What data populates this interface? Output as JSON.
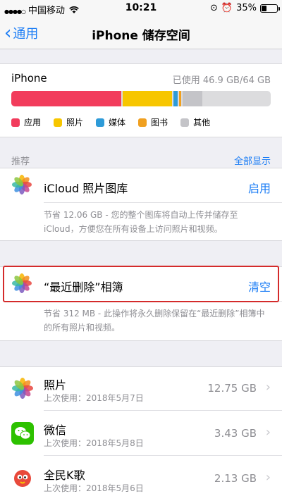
{
  "status_bar": {
    "carrier": "中国移动",
    "time": "10:21",
    "battery": "35%",
    "battery_level": 0.35
  },
  "nav": {
    "back_label": "通用",
    "title": "iPhone 储存空间"
  },
  "storage": {
    "device_name": "iPhone",
    "used_text": "已使用 46.9 GB/64 GB",
    "segments": [
      {
        "key": "apps",
        "fraction": 0.425,
        "color": "#f23c5c"
      },
      {
        "key": "photos",
        "fraction": 0.19,
        "color": "#f7c600"
      },
      {
        "key": "media",
        "fraction": 0.015,
        "color": "#2e9bd8"
      },
      {
        "key": "books",
        "fraction": 0.01,
        "color": "#f0a020"
      },
      {
        "key": "other",
        "fraction": 0.075,
        "color": "#c4c4c8"
      }
    ],
    "legend": [
      {
        "label": "应用",
        "color": "#f23c5c"
      },
      {
        "label": "照片",
        "color": "#f7c600"
      },
      {
        "label": "媒体",
        "color": "#2e9bd8"
      },
      {
        "label": "图书",
        "color": "#f0a020"
      },
      {
        "label": "其他",
        "color": "#c4c4c8"
      }
    ]
  },
  "recommendations": {
    "header": "推荐",
    "show_all": "全部显示",
    "items": [
      {
        "icon": "photos-icon",
        "title": "iCloud 照片图库",
        "action": "启用",
        "description": "节省 12.06 GB - 您的整个图库将自动上传并储存至 iCloud，方便您在所有设备上访问照片和视频。"
      },
      {
        "icon": "photos-icon",
        "title": "“最近删除”相簿",
        "action": "清空",
        "description": "节省 312 MB - 此操作将永久删除保留在“最近删除”相簿中的所有照片和视频。"
      }
    ]
  },
  "apps": [
    {
      "icon": "photos-icon",
      "name": "照片",
      "last_used": "上次使用：2018年5月7日",
      "size": "12.75 GB"
    },
    {
      "icon": "wechat-icon",
      "name": "微信",
      "last_used": "上次使用：2018年5月8日",
      "size": "3.43 GB"
    },
    {
      "icon": "kge-icon",
      "name": "全民K歌",
      "last_used": "上次使用：2018年5月6日",
      "size": "2.13 GB"
    }
  ]
}
